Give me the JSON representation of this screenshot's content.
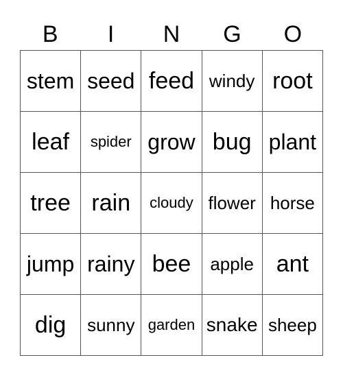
{
  "header": [
    "B",
    "I",
    "N",
    "G",
    "O"
  ],
  "rows": [
    [
      "stem",
      "seed",
      "feed",
      "windy",
      "root"
    ],
    [
      "leaf",
      "spider",
      "grow",
      "bug",
      "plant"
    ],
    [
      "tree",
      "rain",
      "cloudy",
      "flower",
      "horse"
    ],
    [
      "jump",
      "rainy",
      "bee",
      "apple",
      "ant"
    ],
    [
      "dig",
      "sunny",
      "garden",
      "snake",
      "sheep"
    ]
  ]
}
